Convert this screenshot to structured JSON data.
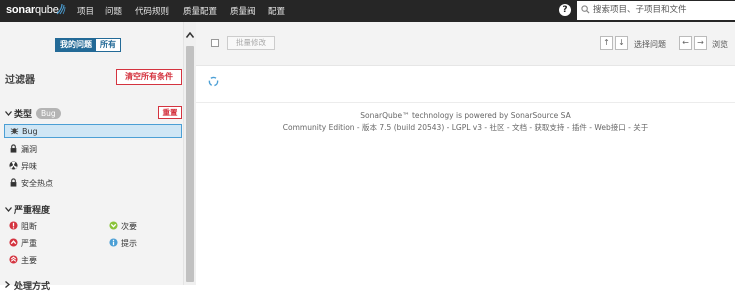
{
  "nav": {
    "logo_a": "sonar",
    "logo_b": "qube",
    "items": [
      "项目",
      "问题",
      "代码规则",
      "质量配置",
      "质量阀",
      "配置"
    ],
    "search_placeholder": "搜索项目、子项目和文件"
  },
  "sidebar": {
    "toggle": {
      "mine": "我的问题",
      "all": "所有"
    },
    "filters_title": "过滤器",
    "clear_all": "清空所有条件",
    "type_facet": {
      "title": "类型",
      "badge": "Bug",
      "reset": "重置",
      "items": [
        "Bug",
        "漏洞",
        "异味",
        "安全热点"
      ]
    },
    "severity_facet": {
      "title": "严重程度",
      "items": [
        "阻断",
        "严重",
        "主要",
        "次要",
        "提示"
      ]
    },
    "next_facet": {
      "title": "处理方式"
    }
  },
  "toolbar": {
    "bulk_change": "批量修改",
    "select_issues": "选择问题",
    "browse": "浏览"
  },
  "footer": {
    "line1": "SonarQube™ technology is powered by SonarSource SA",
    "line2": "Community Edition - 版本 7.5 (build 20543) - LGPL v3 - 社区 - 文档 - 获取支持 - 插件 - Web接口 - 关于"
  },
  "colors": {
    "topbar": "#262626",
    "primary": "#236a97",
    "danger": "#d4333f",
    "selected_bg": "#cfe6f5",
    "blocker": "#d4333f",
    "minor": "#8ac338",
    "info": "#4b9fd5"
  }
}
